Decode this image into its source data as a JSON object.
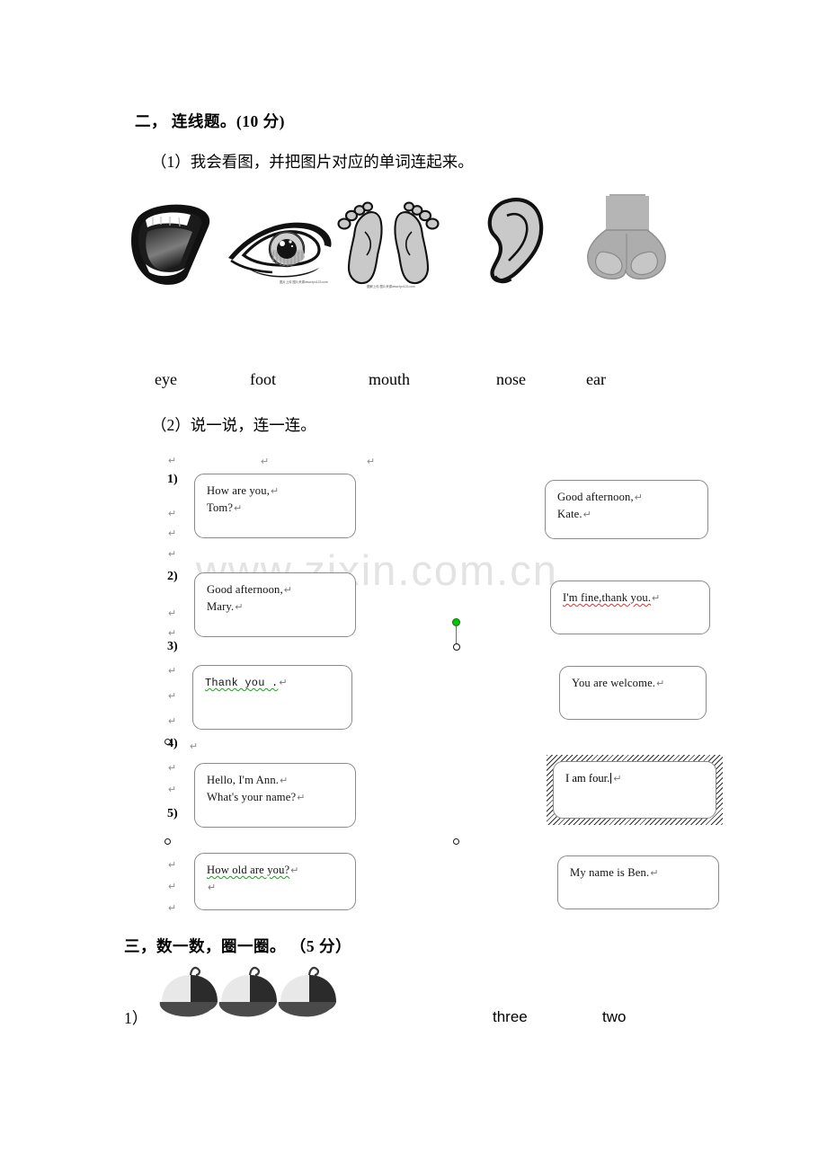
{
  "document": {
    "watermark": "www.zixin.com.cn"
  },
  "section_two": {
    "heading": "二， 连线题。(10 分)",
    "part1": {
      "instruction": "（1）我会看图，并把图片对应的单词连起来。",
      "pictures": [
        {
          "name": "mouth-picture",
          "credit": ""
        },
        {
          "name": "eye-picture",
          "credit": "图片上传 图片来源www.tpx123.com"
        },
        {
          "name": "feet-picture",
          "credit": "图解上传 图片来源www.tpx123.com"
        },
        {
          "name": "ear-picture",
          "credit": ""
        },
        {
          "name": "nose-picture",
          "credit": ""
        }
      ],
      "words": [
        "eye",
        "foot",
        "mouth",
        "nose",
        "ear"
      ]
    },
    "part2": {
      "instruction": "（2）说一说，连一连。",
      "numbers": [
        "1)",
        "2)",
        "3)",
        "4)",
        "5)"
      ],
      "left_bubbles": [
        {
          "lines": [
            "How are you,",
            "Tom?"
          ],
          "mark": "↵"
        },
        {
          "lines": [
            "Good afternoon,",
            "Mary."
          ],
          "mark": "↵"
        },
        {
          "lines": [
            "Thank  you ."
          ],
          "mark": "↵",
          "spell": "green"
        },
        {
          "lines": [
            "Hello, I'm Ann.",
            "What's your name?"
          ],
          "mark": "↵"
        },
        {
          "lines": [
            "How old are you?",
            ""
          ],
          "mark": "↵",
          "spell": "green"
        }
      ],
      "right_bubbles": [
        {
          "lines": [
            "Good afternoon,",
            "Kate."
          ],
          "mark": "↵"
        },
        {
          "lines": [
            "I'm fine,thank you."
          ],
          "mark": "↵",
          "spell": "red"
        },
        {
          "lines": [
            "You are welcome."
          ],
          "mark": "↵"
        },
        {
          "lines": [
            "I am four."
          ],
          "mark": "↵",
          "selected": true
        },
        {
          "lines": [
            "My name is Ben."
          ],
          "mark": "↵"
        }
      ],
      "paragraph_mark": "↵"
    }
  },
  "section_three": {
    "heading": "三，数一数，圈一圈。 （5 分）",
    "items": [
      {
        "number": "1）",
        "picture": "baseball-cap",
        "cap_count": 3,
        "choices": [
          "three",
          "two"
        ]
      }
    ]
  }
}
